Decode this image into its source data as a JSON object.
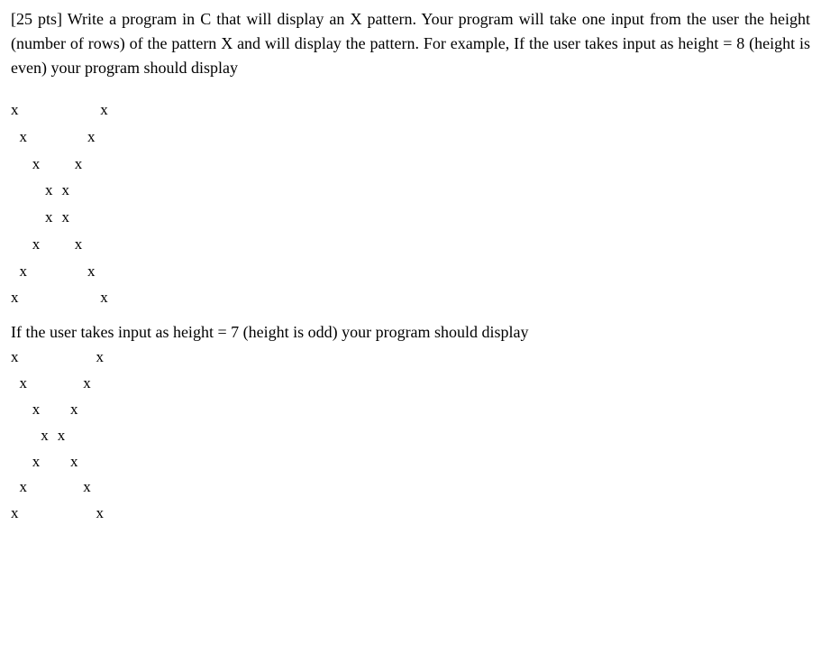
{
  "problem": {
    "points_prefix": "[25 pts]",
    "text": "Write a program in C that will display an X pattern. Your program will take one input from the user the height (number of rows) of the pattern X and will display the pattern. For example, If the user takes input as height = 8 (height is even) your program should display"
  },
  "pattern_even": {
    "height": 8,
    "rows": [
      "x                   x",
      "  x              x",
      "     x        x",
      "        x  x",
      "        x  x",
      "     x        x",
      "  x              x",
      "x                   x"
    ]
  },
  "second_text": "If the user takes input as height = 7 (height is odd) your program should display",
  "pattern_odd": {
    "height": 7,
    "rows": [
      "x                  x",
      "  x             x",
      "     x       x",
      "       x  x",
      "     x       x",
      "  x             x",
      "x                  x"
    ]
  }
}
